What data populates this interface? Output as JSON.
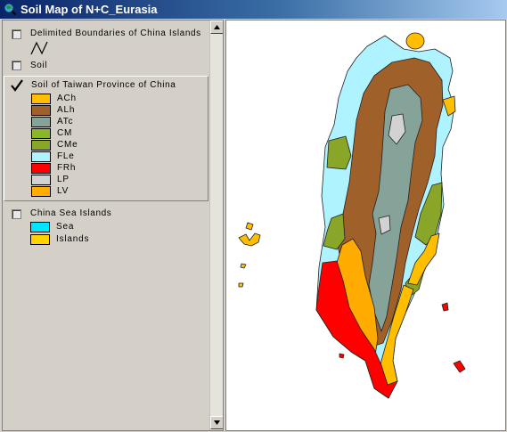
{
  "window": {
    "title": "Soil Map of N+C_Eurasia",
    "icon": "map-globe-icon"
  },
  "toc": {
    "layers": [
      {
        "name": "Delimited Boundaries of China Islands",
        "checked": false,
        "symbol": "line-symbol"
      },
      {
        "name": "Soil",
        "checked": false
      },
      {
        "name": "Soil of Taiwan Province of China",
        "checked": true,
        "legend": [
          {
            "label": "ACh",
            "color": "#ffbe00"
          },
          {
            "label": "ALh",
            "color": "#a0602a"
          },
          {
            "label": "ATc",
            "color": "#86a39a"
          },
          {
            "label": "CM",
            "color": "#8cb62a"
          },
          {
            "label": "CMe",
            "color": "#8aa629"
          },
          {
            "label": "FLe",
            "color": "#aef3ff"
          },
          {
            "label": "FRh",
            "color": "#ff0000"
          },
          {
            "label": "LP",
            "color": "#d2d2d2"
          },
          {
            "label": "LV",
            "color": "#ffab00"
          }
        ]
      },
      {
        "name": "China Sea Islands",
        "checked": false,
        "legend": [
          {
            "label": "Sea",
            "color": "#00e6ff"
          },
          {
            "label": "Islands",
            "color": "#ffd200"
          }
        ]
      }
    ]
  },
  "map": {
    "region": "Taiwan"
  }
}
